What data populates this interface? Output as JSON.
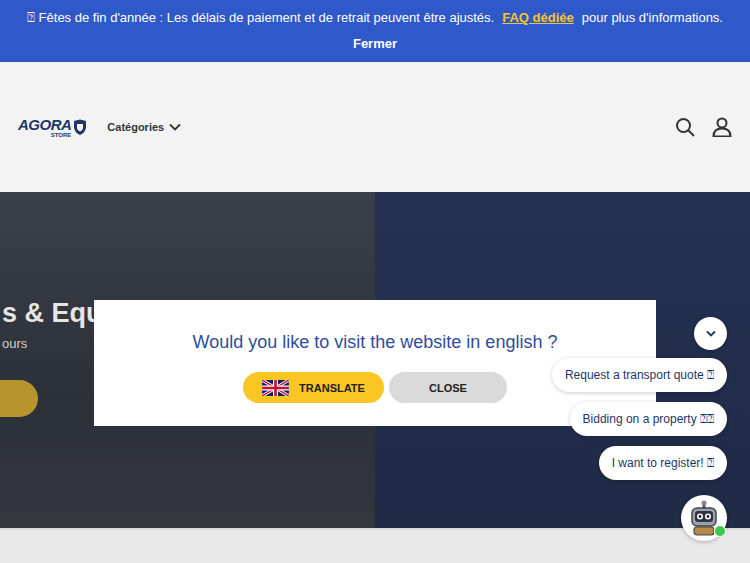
{
  "banner": {
    "icon": "⍰",
    "message": "Fêtes de fin d'année : Les délais de paiement et de retrait peuvent être ajustés.",
    "link": "FAQ dédiée",
    "suffix": "pour plus d'informations.",
    "close": "Fermer"
  },
  "header": {
    "logo": "AGORA",
    "logo_sub": "STORE",
    "menu": "Catégories"
  },
  "hero": {
    "title": "s & Equ",
    "subtitle": "ours"
  },
  "modal": {
    "title": "Would you like to visit the website in english ?",
    "buttons": [
      {
        "label": "TRANSLATE",
        "kind": "primary"
      },
      {
        "label": "CLOSE",
        "kind": "secondary"
      }
    ]
  },
  "chat": {
    "suggestions": [
      "Request a transport quote ⍰",
      "Bidding on a property ⍰⍰",
      "I want to register! ⍰"
    ],
    "online": true
  }
}
